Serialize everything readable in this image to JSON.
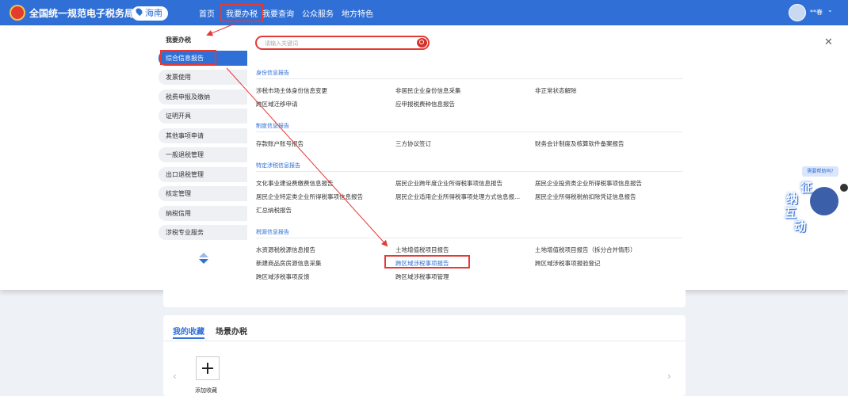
{
  "header": {
    "brand": "全国统一规范电子税务局",
    "region": "海南",
    "nav": [
      "首页",
      "我要办税",
      "我要查询",
      "公众服务",
      "地方特色"
    ],
    "username": "**春",
    "colors": {
      "primary": "#2f6fd6",
      "highlight": "#e53935"
    }
  },
  "sidebar": {
    "title": "我要办税",
    "items": [
      "综合信息报告",
      "发票使用",
      "税费申报及缴纳",
      "证明开具",
      "其他事项申请",
      "一般退税管理",
      "出口退税管理",
      "核定管理",
      "纳税信用",
      "涉税专业服务"
    ]
  },
  "search": {
    "placeholder": "请输入关键词"
  },
  "sections": [
    {
      "title": "身份信息报告",
      "links": [
        "涉税市场主体身份信息变更",
        "非居民企业身份信息采集",
        "非正常状态解除",
        "跨区域迁移申请",
        "应申报税费种信息报告"
      ]
    },
    {
      "title": "制度信息报告",
      "links": [
        "存款账户账号报告",
        "三方协议签订",
        "财务会计制度及核算软件备案报告"
      ]
    },
    {
      "title": "特定涉税信息报告",
      "links": [
        "文化事业建设费缴费信息报告",
        "居民企业跨年度企业所得税事项信息报告",
        "居民企业投资类企业所得税事项信息报告",
        "居民企业特定类企业所得税事项信息报告",
        "居民企业适用企业所得税事项处理方式信息报...",
        "居民企业所得税税前扣除凭证信息报告",
        "汇总纳税报告"
      ]
    },
    {
      "title": "税源信息报告",
      "links": [
        "水资源税税源信息报告",
        "土地增值税项目报告",
        "土地增值税项目报告（拆分合并情形）",
        "新建商品房房源信息采集",
        "跨区域涉税事项报告",
        "跨区域涉税事项报验登记",
        "跨区域涉税事项反馈",
        "跨区域涉税事项管理"
      ]
    }
  ],
  "assistant": {
    "help": "需要帮助吗?",
    "label": "征纳互动"
  },
  "favorites": {
    "tabs": [
      "我的收藏",
      "场景办税"
    ],
    "add_label": "添加收藏"
  }
}
